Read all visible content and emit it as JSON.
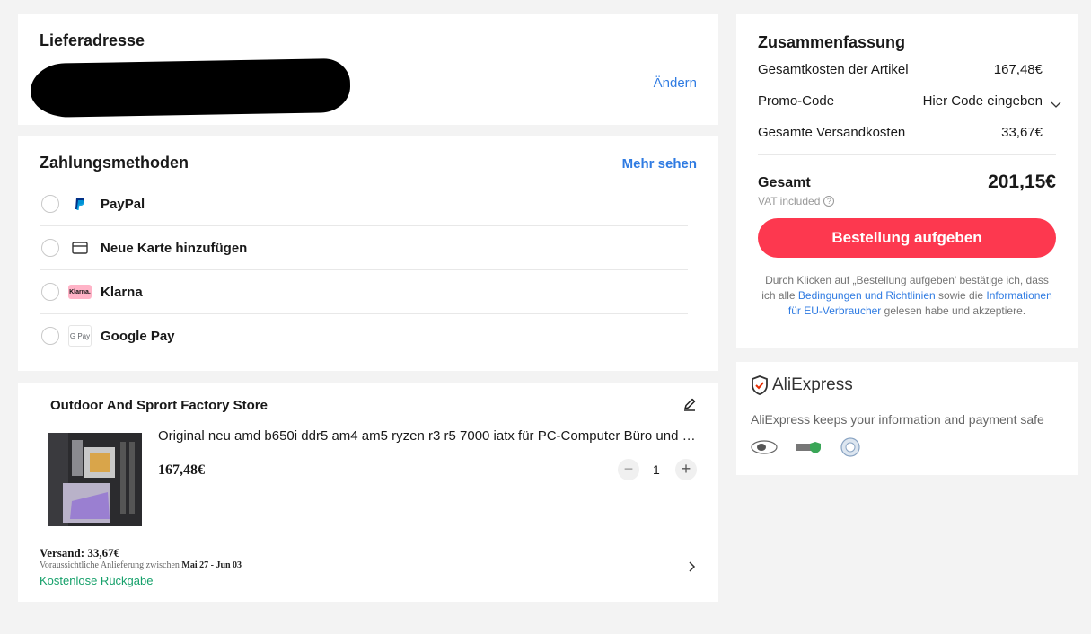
{
  "address": {
    "title": "Lieferadresse",
    "change_label": "Ändern"
  },
  "payment": {
    "title": "Zahlungsmethoden",
    "more_label": "Mehr sehen",
    "methods": [
      {
        "label": "PayPal",
        "icon": "paypal-icon"
      },
      {
        "label": "Neue Karte hinzufügen",
        "icon": "credit-card-icon"
      },
      {
        "label": "Klarna",
        "icon": "klarna-icon",
        "icon_text": "Klarna."
      },
      {
        "label": "Google Pay",
        "icon": "google-pay-icon",
        "icon_text": "G Pay"
      }
    ]
  },
  "store": {
    "name": "Outdoor And Sprort Factory Store",
    "product_title": "Original neu amd b650i ddr5 am4 am5 ryzen r3 r5 7000 iatx für PC-Computer Büro und H...",
    "price": "167,48€",
    "quantity": "1",
    "shipping_fee": "Versand: 33,67€",
    "delivery_prefix": "Voraussichtliche Anlieferung zwischen",
    "delivery_dates": "Mai 27 - Jun 03",
    "free_return": "Kostenlose Rückgabe"
  },
  "summary": {
    "title": "Zusammenfassung",
    "items_label": "Gesamtkosten der Artikel",
    "items_value": "167,48€",
    "promo_label": "Promo-Code",
    "promo_value": "Hier Code eingeben",
    "shipping_label": "Gesamte Versandkosten",
    "shipping_value": "33,67€",
    "total_label": "Gesamt",
    "total_value": "201,15€",
    "vat_label": "VAT included",
    "order_button": "Bestellung aufgeben",
    "legal_1": "Durch Klicken auf „Bestellung aufgeben' bestätige ich, dass ich alle",
    "legal_link_1": "Bedingungen und Richtlinien",
    "legal_2": "sowie die",
    "legal_link_2": "Informationen für EU-Verbraucher",
    "legal_3": "gelesen habe und akzeptiere."
  },
  "trust": {
    "brand": "AliExpress",
    "text": "AliExpress keeps your information and payment safe"
  },
  "colors": {
    "accent_red": "#fd384f",
    "link_blue": "#2f7be2",
    "success_green": "#15a06a"
  }
}
